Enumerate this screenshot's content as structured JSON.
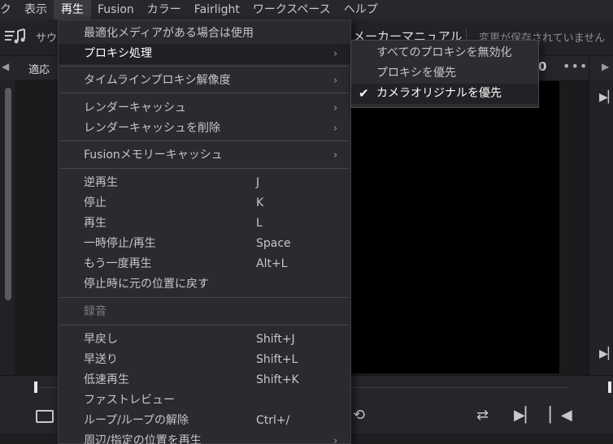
{
  "menubar": {
    "items": [
      "ク",
      "表示",
      "再生",
      "Fusion",
      "カラー",
      "Fairlight",
      "ワークスペース",
      "ヘルプ"
    ],
    "active_index": 2
  },
  "toolbar": {
    "sound_label": "サウン",
    "title": "メーカーマニュアル",
    "status": "変更が保存されていません"
  },
  "viewer_header": {
    "fit_label": "適応",
    "number": "0",
    "more": "•••"
  },
  "dropdown": {
    "items": [
      {
        "label": "最適化メディアがある場合は使用",
        "shortcut": "",
        "submenu": false,
        "disabled": false
      },
      {
        "label": "プロキシ処理",
        "shortcut": "",
        "submenu": true,
        "disabled": false
      },
      {
        "label": "タイムラインプロキシ解像度",
        "shortcut": "",
        "submenu": true,
        "disabled": false
      },
      {
        "label": "レンダーキャッシュ",
        "shortcut": "",
        "submenu": true,
        "disabled": false
      },
      {
        "label": "レンダーキャッシュを削除",
        "shortcut": "",
        "submenu": true,
        "disabled": false
      },
      {
        "label": "Fusionメモリーキャッシュ",
        "shortcut": "",
        "submenu": true,
        "disabled": false
      },
      {
        "label": "逆再生",
        "shortcut": "J",
        "submenu": false,
        "disabled": false
      },
      {
        "label": "停止",
        "shortcut": "K",
        "submenu": false,
        "disabled": false
      },
      {
        "label": "再生",
        "shortcut": "L",
        "submenu": false,
        "disabled": false
      },
      {
        "label": "一時停止/再生",
        "shortcut": "Space",
        "submenu": false,
        "disabled": false
      },
      {
        "label": "もう一度再生",
        "shortcut": "Alt+L",
        "submenu": false,
        "disabled": false
      },
      {
        "label": "停止時に元の位置に戻す",
        "shortcut": "",
        "submenu": false,
        "disabled": false
      },
      {
        "label": "録音",
        "shortcut": "",
        "submenu": false,
        "disabled": true
      },
      {
        "label": "早戻し",
        "shortcut": "Shift+J",
        "submenu": false,
        "disabled": false
      },
      {
        "label": "早送り",
        "shortcut": "Shift+L",
        "submenu": false,
        "disabled": false
      },
      {
        "label": "低速再生",
        "shortcut": "Shift+K",
        "submenu": false,
        "disabled": false
      },
      {
        "label": "ファストレビュー",
        "shortcut": "",
        "submenu": false,
        "disabled": false
      },
      {
        "label": "ループ/ループの解除",
        "shortcut": "Ctrl+/",
        "submenu": false,
        "disabled": false
      },
      {
        "label": "周辺/指定の位置を再生",
        "shortcut": "",
        "submenu": true,
        "disabled": false
      }
    ],
    "highlighted_index": 1
  },
  "submenu": {
    "items": [
      {
        "label": "すべてのプロキシを無効化",
        "checked": false
      },
      {
        "label": "プロキシを優先",
        "checked": false
      },
      {
        "label": "カメラオリジナルを優先",
        "checked": true
      }
    ]
  },
  "icons": {
    "submenu_arrow": "chevron-right-icon",
    "check": "checkmark-icon"
  },
  "colors": {
    "menu_bg": "#2b2b2f",
    "highlight_bg": "#202024",
    "canvas": "#000000"
  }
}
